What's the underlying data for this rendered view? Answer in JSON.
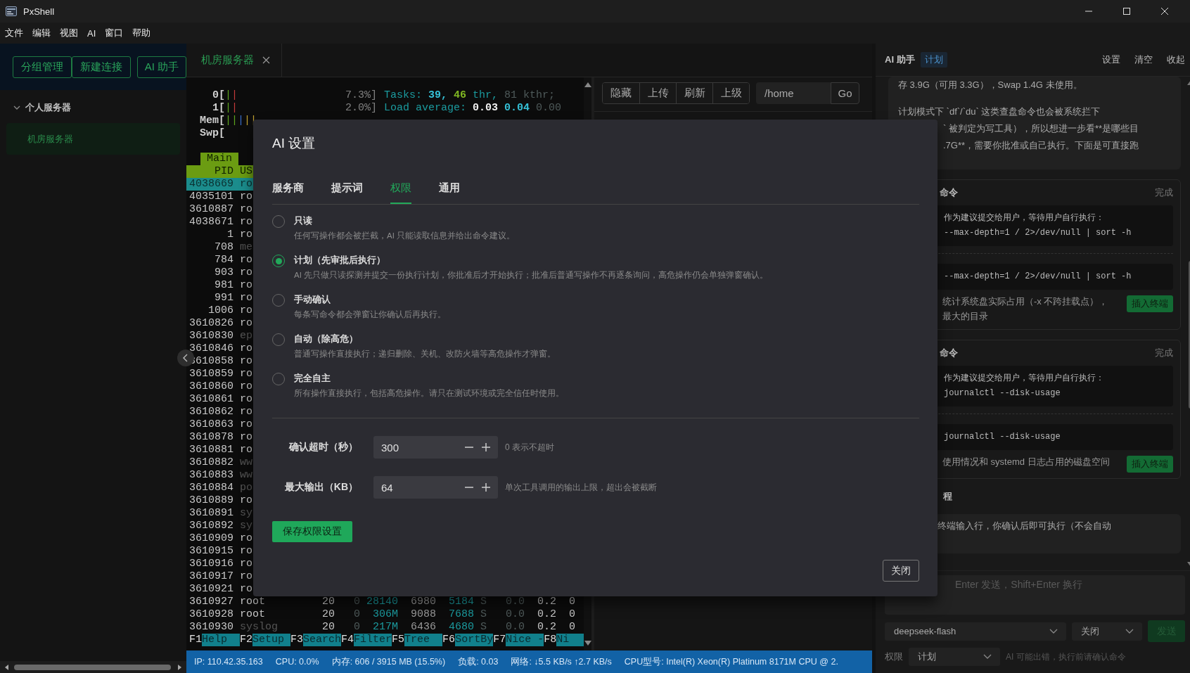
{
  "window": {
    "title": "PxShell"
  },
  "menu": [
    "文件",
    "编辑",
    "视图",
    "AI",
    "窗口",
    "帮助"
  ],
  "sidebar": {
    "buttons": [
      "分组管理",
      "新建连接",
      "AI 助手"
    ],
    "groups": [
      {
        "label": "个人服务器",
        "expanded": true,
        "children": [
          {
            "label": "机房服务器",
            "selected": true
          }
        ]
      }
    ]
  },
  "tabs": [
    {
      "label": "机房服务器",
      "selected": true
    }
  ],
  "terminal": {
    "meters": [
      {
        "label": "0[",
        "bars": [
          {
            "text": "|",
            "kind": "green"
          },
          {
            "text": "|",
            "kind": "red"
          }
        ],
        "value": "7.3%]"
      },
      {
        "label": "1[",
        "bars": [
          {
            "text": "|",
            "kind": "green"
          },
          {
            "text": "|",
            "kind": "red"
          }
        ],
        "value": "2.0%]"
      },
      {
        "label": "Mem[",
        "bars": [
          {
            "text": "||",
            "kind": "green"
          },
          {
            "text": "|",
            "kind": "blue"
          },
          {
            "text": "||",
            "kind": "yellow"
          }
        ]
      },
      {
        "label": "Swp["
      }
    ],
    "summary": [
      [
        {
          "text": "Tasks:",
          "kind": "label"
        },
        {
          "text": "39,",
          "kind": "count"
        },
        {
          "text": "46",
          "kind": "green"
        },
        {
          "text": "thr,",
          "kind": "label"
        },
        {
          "text": "81 kthr;",
          "kind": "dim"
        }
      ],
      [
        {
          "text": "Load average:",
          "kind": "label"
        },
        {
          "text": "0.03",
          "kind": "bold"
        },
        {
          "text": "0.04",
          "kind": "count"
        },
        {
          "text": "0.00",
          "kind": "dim"
        }
      ]
    ],
    "screen_tab": "Main",
    "header": [
      "PID",
      "US"
    ],
    "processes": [
      {
        "pid": "4038669",
        "user": "ro",
        "selected": true,
        "dimmed": false
      },
      {
        "pid": "4035101",
        "user": "ro",
        "selected": false,
        "dimmed": false
      },
      {
        "pid": "3610887",
        "user": "ro",
        "selected": false,
        "dimmed": false
      },
      {
        "pid": "4038671",
        "user": "ro",
        "selected": false,
        "dimmed": false
      },
      {
        "pid": "1",
        "user": "ro",
        "selected": false,
        "dimmed": false
      },
      {
        "pid": "708",
        "user": "me",
        "selected": false,
        "dimmed": true
      },
      {
        "pid": "784",
        "user": "ro",
        "selected": false,
        "dimmed": false
      },
      {
        "pid": "903",
        "user": "ro",
        "selected": false,
        "dimmed": false
      },
      {
        "pid": "981",
        "user": "ro",
        "selected": false,
        "dimmed": false
      },
      {
        "pid": "991",
        "user": "ro",
        "selected": false,
        "dimmed": false
      },
      {
        "pid": "1006",
        "user": "ro",
        "selected": false,
        "dimmed": false
      },
      {
        "pid": "3610826",
        "user": "ro",
        "selected": false,
        "dimmed": false
      },
      {
        "pid": "3610830",
        "user": "ep",
        "selected": false,
        "dimmed": true
      },
      {
        "pid": "3610846",
        "user": "ro",
        "selected": false,
        "dimmed": false
      },
      {
        "pid": "3610858",
        "user": "ro",
        "selected": false,
        "dimmed": false
      },
      {
        "pid": "3610859",
        "user": "ro",
        "selected": false,
        "dimmed": false
      },
      {
        "pid": "3610860",
        "user": "ro",
        "selected": false,
        "dimmed": false
      },
      {
        "pid": "3610861",
        "user": "ro",
        "selected": false,
        "dimmed": false
      },
      {
        "pid": "3610862",
        "user": "ro",
        "selected": false,
        "dimmed": false
      },
      {
        "pid": "3610863",
        "user": "ro",
        "selected": false,
        "dimmed": false
      },
      {
        "pid": "3610878",
        "user": "ro",
        "selected": false,
        "dimmed": false
      },
      {
        "pid": "3610881",
        "user": "ro",
        "selected": false,
        "dimmed": false
      },
      {
        "pid": "3610882",
        "user": "ww",
        "selected": false,
        "dimmed": true
      },
      {
        "pid": "3610883",
        "user": "ww",
        "selected": false,
        "dimmed": true
      },
      {
        "pid": "3610884",
        "user": "po",
        "selected": false,
        "dimmed": true
      },
      {
        "pid": "3610889",
        "user": "ro",
        "selected": false,
        "dimmed": false
      },
      {
        "pid": "3610891",
        "user": "sy",
        "selected": false,
        "dimmed": true
      },
      {
        "pid": "3610892",
        "user": "sy",
        "selected": false,
        "dimmed": true
      },
      {
        "pid": "3610909",
        "user": "ro",
        "selected": false,
        "dimmed": false
      },
      {
        "pid": "3610915",
        "user": "ro",
        "selected": false,
        "dimmed": false
      },
      {
        "pid": "3610916",
        "user": "ro",
        "selected": false,
        "dimmed": false
      },
      {
        "pid": "3610917",
        "user": "ro",
        "selected": false,
        "dimmed": false
      },
      {
        "pid": "3610921",
        "user": "ro",
        "selected": false,
        "dimmed": false
      },
      {
        "pid": "3610927",
        "user": "root",
        "selected": false,
        "dimmed": false,
        "pri": "20",
        "ni": "0",
        "virt": "28140",
        "res": "6980",
        "shr": "5184",
        "state": "S",
        "cpu": "0.0",
        "mem": "0.2",
        "column_11": "0"
      },
      {
        "pid": "3610928",
        "user": "root",
        "selected": false,
        "dimmed": false,
        "pri": "20",
        "ni": "0",
        "virt": "306M",
        "res": "9088",
        "shr": "7688",
        "state": "S",
        "cpu": "0.0",
        "mem": "0.2",
        "column_11": "0"
      },
      {
        "pid": "3610930",
        "user": "syslog",
        "selected": false,
        "dimmed": true,
        "pri": "20",
        "ni": "0",
        "virt": "217M",
        "res": "6436",
        "shr": "4680",
        "state": "S",
        "cpu": "0.0",
        "mem": "0.2",
        "column_11": "0"
      }
    ],
    "function_keys": [
      {
        "key": "F1",
        "label": "Help"
      },
      {
        "key": "F2",
        "label": "Setup"
      },
      {
        "key": "F3",
        "label": "Search"
      },
      {
        "key": "F4",
        "label": "Filter"
      },
      {
        "key": "F5",
        "label": "Tree"
      },
      {
        "key": "F6",
        "label": "SortBy"
      },
      {
        "key": "F7",
        "label": "Nice -"
      },
      {
        "key": "F8",
        "label": "Ni"
      }
    ]
  },
  "files": {
    "toolbar": [
      "隐藏",
      "上传",
      "刷新",
      "上级"
    ],
    "path": "/home",
    "go": "Go"
  },
  "status_bar": [
    "IP: 110.42.35.163",
    "CPU: 0.0%",
    "内存: 606 / 3915 MB (15.5%)",
    "负载: 0.03",
    "网络: ↓5.5 KB/s ↑2.7 KB/s",
    "CPU型号: Intel(R) Xeon(R) Platinum 8171M CPU @ 2."
  ],
  "assistant": {
    "title": "AI 助手",
    "mode_badge": "计划",
    "actions": [
      "设置",
      "清空",
      "收起"
    ],
    "message": [
      [
        "存 3.9G（可用 3.3G），Swap 1.4G 未使用。"
      ],
      [
        "计划模式下 `df`/`du` 这类查盘命令也会被系统拦下",
        "` 被判定为写工具），所以想进一步看**是哪些目",
        ".7G**，需要你批准或自己执行。下面是可直接跑"
      ]
    ],
    "cards": [
      {
        "title": "命令",
        "status": "完成",
        "proposal": [
          "作为建议提交给用户，等待用户自行执行：",
          "--max-depth=1 / 2>/dev/null | sort -h"
        ],
        "command": "--max-depth=1 / 2>/dev/null | sort -h",
        "description": [
          "统计系统盘实际占用（-x 不跨挂载点），",
          "最大的目录"
        ],
        "action": "插入终端"
      },
      {
        "title": "命令",
        "status": "完成",
        "proposal": [
          "作为建议提交给用户，等待用户自行执行：",
          "journalctl --disk-usage"
        ],
        "command": "journalctl --disk-usage",
        "description": [
          "使用情况和 systemd 日志占用的磁盘空间"
        ],
        "action": "插入终端"
      }
    ],
    "section_heading": "程",
    "note": "终端输入行，你确认后即可执行（不会自动",
    "input": {
      "placeholder": "Enter 发送，Shift+Enter 换行"
    },
    "model": "deepseek-flash",
    "approval": "关闭",
    "send": {
      "label": "发送",
      "disabled": true
    },
    "permission": {
      "label": "权限",
      "value": "计划"
    },
    "disclaimer": "AI 可能出错，执行前请确认命令"
  },
  "dialog": {
    "title": "AI 设置",
    "tabs": [
      {
        "label": "服务商",
        "selected": false
      },
      {
        "label": "提示词",
        "selected": false
      },
      {
        "label": "权限",
        "selected": true
      },
      {
        "label": "通用",
        "selected": false
      }
    ],
    "modes": [
      {
        "label": "只读",
        "description": "任何写操作都会被拦截，AI 只能读取信息并给出命令建议。",
        "selected": false
      },
      {
        "label": "计划（先审批后执行）",
        "description": "AI 先只做只读探测并提交一份执行计划，你批准后才开始执行；批准后普通写操作不再逐条询问，高危操作仍会单独弹窗确认。",
        "selected": true
      },
      {
        "label": "手动确认",
        "description": "每条写命令都会弹窗让你确认后再执行。",
        "selected": false
      },
      {
        "label": "自动（除高危）",
        "description": "普通写操作直接执行；递归删除、关机、改防火墙等高危操作才弹窗。",
        "selected": false
      },
      {
        "label": "完全自主",
        "description": "所有操作直接执行，包括高危操作。请只在测试环境或完全信任时使用。",
        "selected": false
      }
    ],
    "fields": [
      {
        "label": "确认超时（秒）",
        "value": "300",
        "hint": "0 表示不超时"
      },
      {
        "label": "最大输出（KB）",
        "value": "64",
        "hint": "单次工具调用的输出上限，超出会被截断"
      }
    ],
    "save": "保存权限设置",
    "close": "关闭"
  }
}
